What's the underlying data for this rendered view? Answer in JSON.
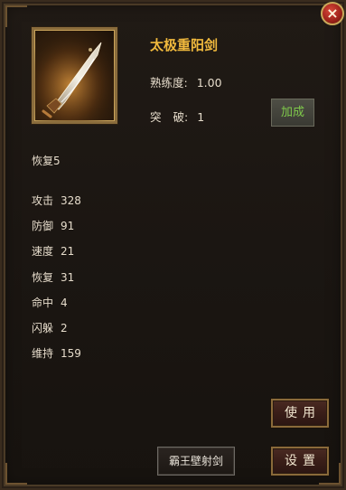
{
  "item": {
    "name": "太极重阳剑",
    "proficiency_label": "熟练度:",
    "proficiency_value": "1.00",
    "breakthrough_label": "突破",
    "breakthrough_colon": ":",
    "breakthrough_value": "1",
    "image_icon": "sword-icon"
  },
  "effect_text": "恢复5",
  "stats": [
    {
      "label": "攻击",
      "value": "328"
    },
    {
      "label": "防御",
      "value": "91"
    },
    {
      "label": "速度",
      "value": "21"
    },
    {
      "label": "恢复",
      "value": "31"
    },
    {
      "label": "命中",
      "value": "4"
    },
    {
      "label": "闪躲",
      "value": "2"
    },
    {
      "label": "维持",
      "value": "159"
    }
  ],
  "buttons": {
    "enhance": "加成",
    "use": "使用",
    "settings": "设置",
    "skill": "霸王壁射剑",
    "close": "×"
  },
  "colors": {
    "item_name": "#f0b93d",
    "enhance_text": "#7fc94b",
    "close_button": "#a2241c"
  }
}
